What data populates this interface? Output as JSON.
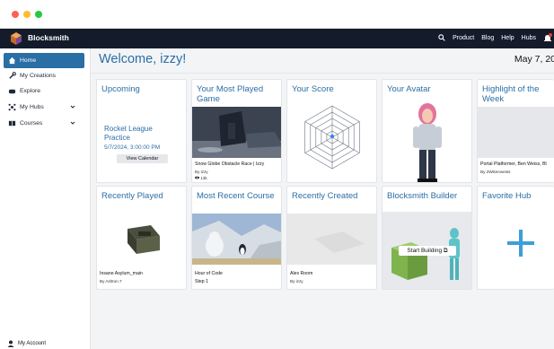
{
  "app": {
    "brand": "Blocksmith"
  },
  "nav": {
    "links": [
      "Product",
      "Blog",
      "Help",
      "Hubs"
    ]
  },
  "sidebar": {
    "items": [
      {
        "label": "Home",
        "icon": "home-icon",
        "active": true
      },
      {
        "label": "My Creations",
        "icon": "wrench-icon"
      },
      {
        "label": "Explore",
        "icon": "gamepad-icon"
      },
      {
        "label": "My Hubs",
        "icon": "hub-icon",
        "expandable": true
      },
      {
        "label": "Courses",
        "icon": "book-icon",
        "expandable": true
      }
    ],
    "account": "My Account"
  },
  "header": {
    "welcome": "Welcome, izzy!",
    "date": "May 7, 20"
  },
  "cards": {
    "upcoming": {
      "title": "Upcoming",
      "event": "Rocket League Practice",
      "datetime": "5/7/2024, 3:00:00 PM",
      "button": "View Calendar"
    },
    "most_played": {
      "title": "Your Most Played Game",
      "name": "Snow Globe Obstacle Race | Izzy",
      "by": "By izzy",
      "views": "13k"
    },
    "score": {
      "title": "Your Score"
    },
    "avatar": {
      "title": "Your Avatar"
    },
    "highlight": {
      "title": "Highlight of the Week",
      "name": "Portal Platformer, Ben Weiss, Bl",
      "by": "By 2Wikenweiss"
    },
    "recently_played": {
      "title": "Recently Played",
      "name": "Insane Asylum_main",
      "by": "By Ashton.7"
    },
    "recent_course": {
      "title": "Most Recent Course",
      "name": "Hour of Code",
      "step": "Step 1"
    },
    "recently_created": {
      "title": "Recently Created",
      "name": "Alex Room",
      "by": "By izzy"
    },
    "builder": {
      "title": "Blocksmith Builder",
      "button": "Start Building"
    },
    "favorite_hub": {
      "title": "Favorite Hub"
    }
  },
  "colors": {
    "accent": "#2a6ea6",
    "topbar": "#141c2b",
    "hub_plus": "#3b9fd8"
  }
}
